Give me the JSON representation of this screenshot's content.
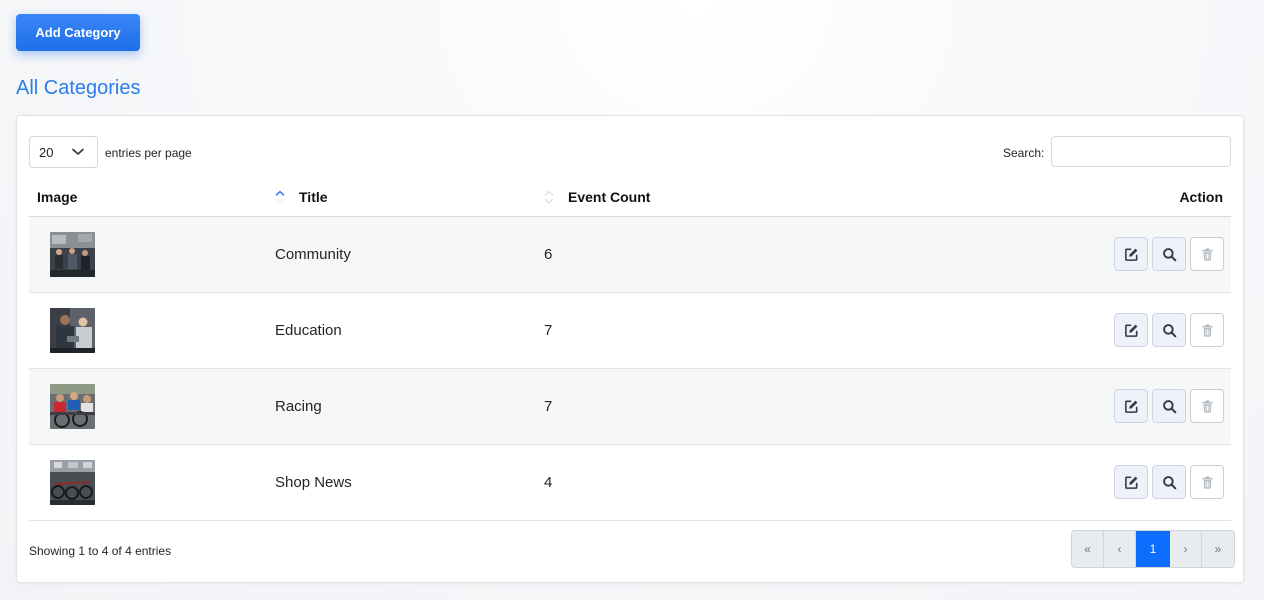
{
  "toolbar": {
    "add_label": "Add Category"
  },
  "page": {
    "title": "All Categories"
  },
  "table_controls": {
    "per_page_value": "20",
    "per_page_label": "entries per page",
    "search_label": "Search:",
    "search_value": ""
  },
  "columns": {
    "image": "Image",
    "title": "Title",
    "event_count": "Event Count",
    "action": "Action"
  },
  "rows": [
    {
      "title": "Community",
      "event_count": "6"
    },
    {
      "title": "Education",
      "event_count": "7"
    },
    {
      "title": "Racing",
      "event_count": "7"
    },
    {
      "title": "Shop News",
      "event_count": "4"
    }
  ],
  "footer": {
    "showing": "Showing 1 to 4 of 4 entries"
  },
  "pagination": {
    "first": "«",
    "prev": "‹",
    "current": "1",
    "next": "›",
    "last": "»"
  },
  "icons": {
    "edit": "edit-icon",
    "view": "search-icon",
    "delete": "trash-icon",
    "sort": "sort-icon"
  },
  "colors": {
    "primary": "#2b7de9",
    "active_page": "#0d6efd"
  }
}
